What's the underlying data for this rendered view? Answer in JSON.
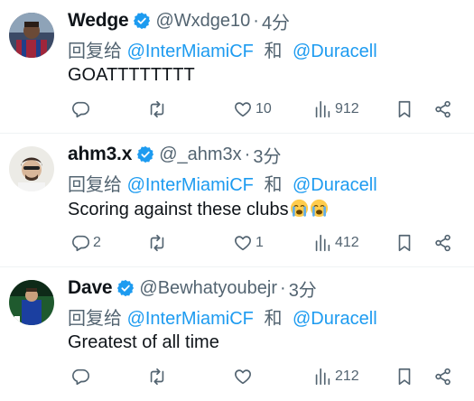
{
  "tweets": [
    {
      "name": "Wedge",
      "handle": "@Wxdge10",
      "time": "4分",
      "reply_prefix": "回复给",
      "mention1": "@InterMiamiCF",
      "conj": "和",
      "mention2": "@Duracell",
      "text": "GOATTTTTTTT",
      "replies": "",
      "retweets": "",
      "likes": "10",
      "views": "912"
    },
    {
      "name": "ahm3.x",
      "handle": "@_ahm3x",
      "time": "3分",
      "reply_prefix": "回复给",
      "mention1": "@InterMiamiCF",
      "conj": "和",
      "mention2": "@Duracell",
      "text": "Scoring against these clubs",
      "replies": "2",
      "retweets": "",
      "likes": "1",
      "views": "412"
    },
    {
      "name": "Dave",
      "handle": "@Bewhatyoubejr",
      "time": "3分",
      "reply_prefix": "回复给",
      "mention1": "@InterMiamiCF",
      "conj": "和",
      "mention2": "@Duracell",
      "text": "Greatest of all time",
      "replies": "",
      "retweets": "",
      "likes": "",
      "views": "212"
    }
  ],
  "separator": "·",
  "colors": {
    "accent": "#1d9bf0",
    "muted": "#536471",
    "text": "#0f1419"
  },
  "icons": [
    "verified-badge-icon",
    "reply-icon",
    "retweet-icon",
    "like-icon",
    "views-icon",
    "bookmark-icon",
    "share-icon",
    "crying-emoji-icon"
  ]
}
